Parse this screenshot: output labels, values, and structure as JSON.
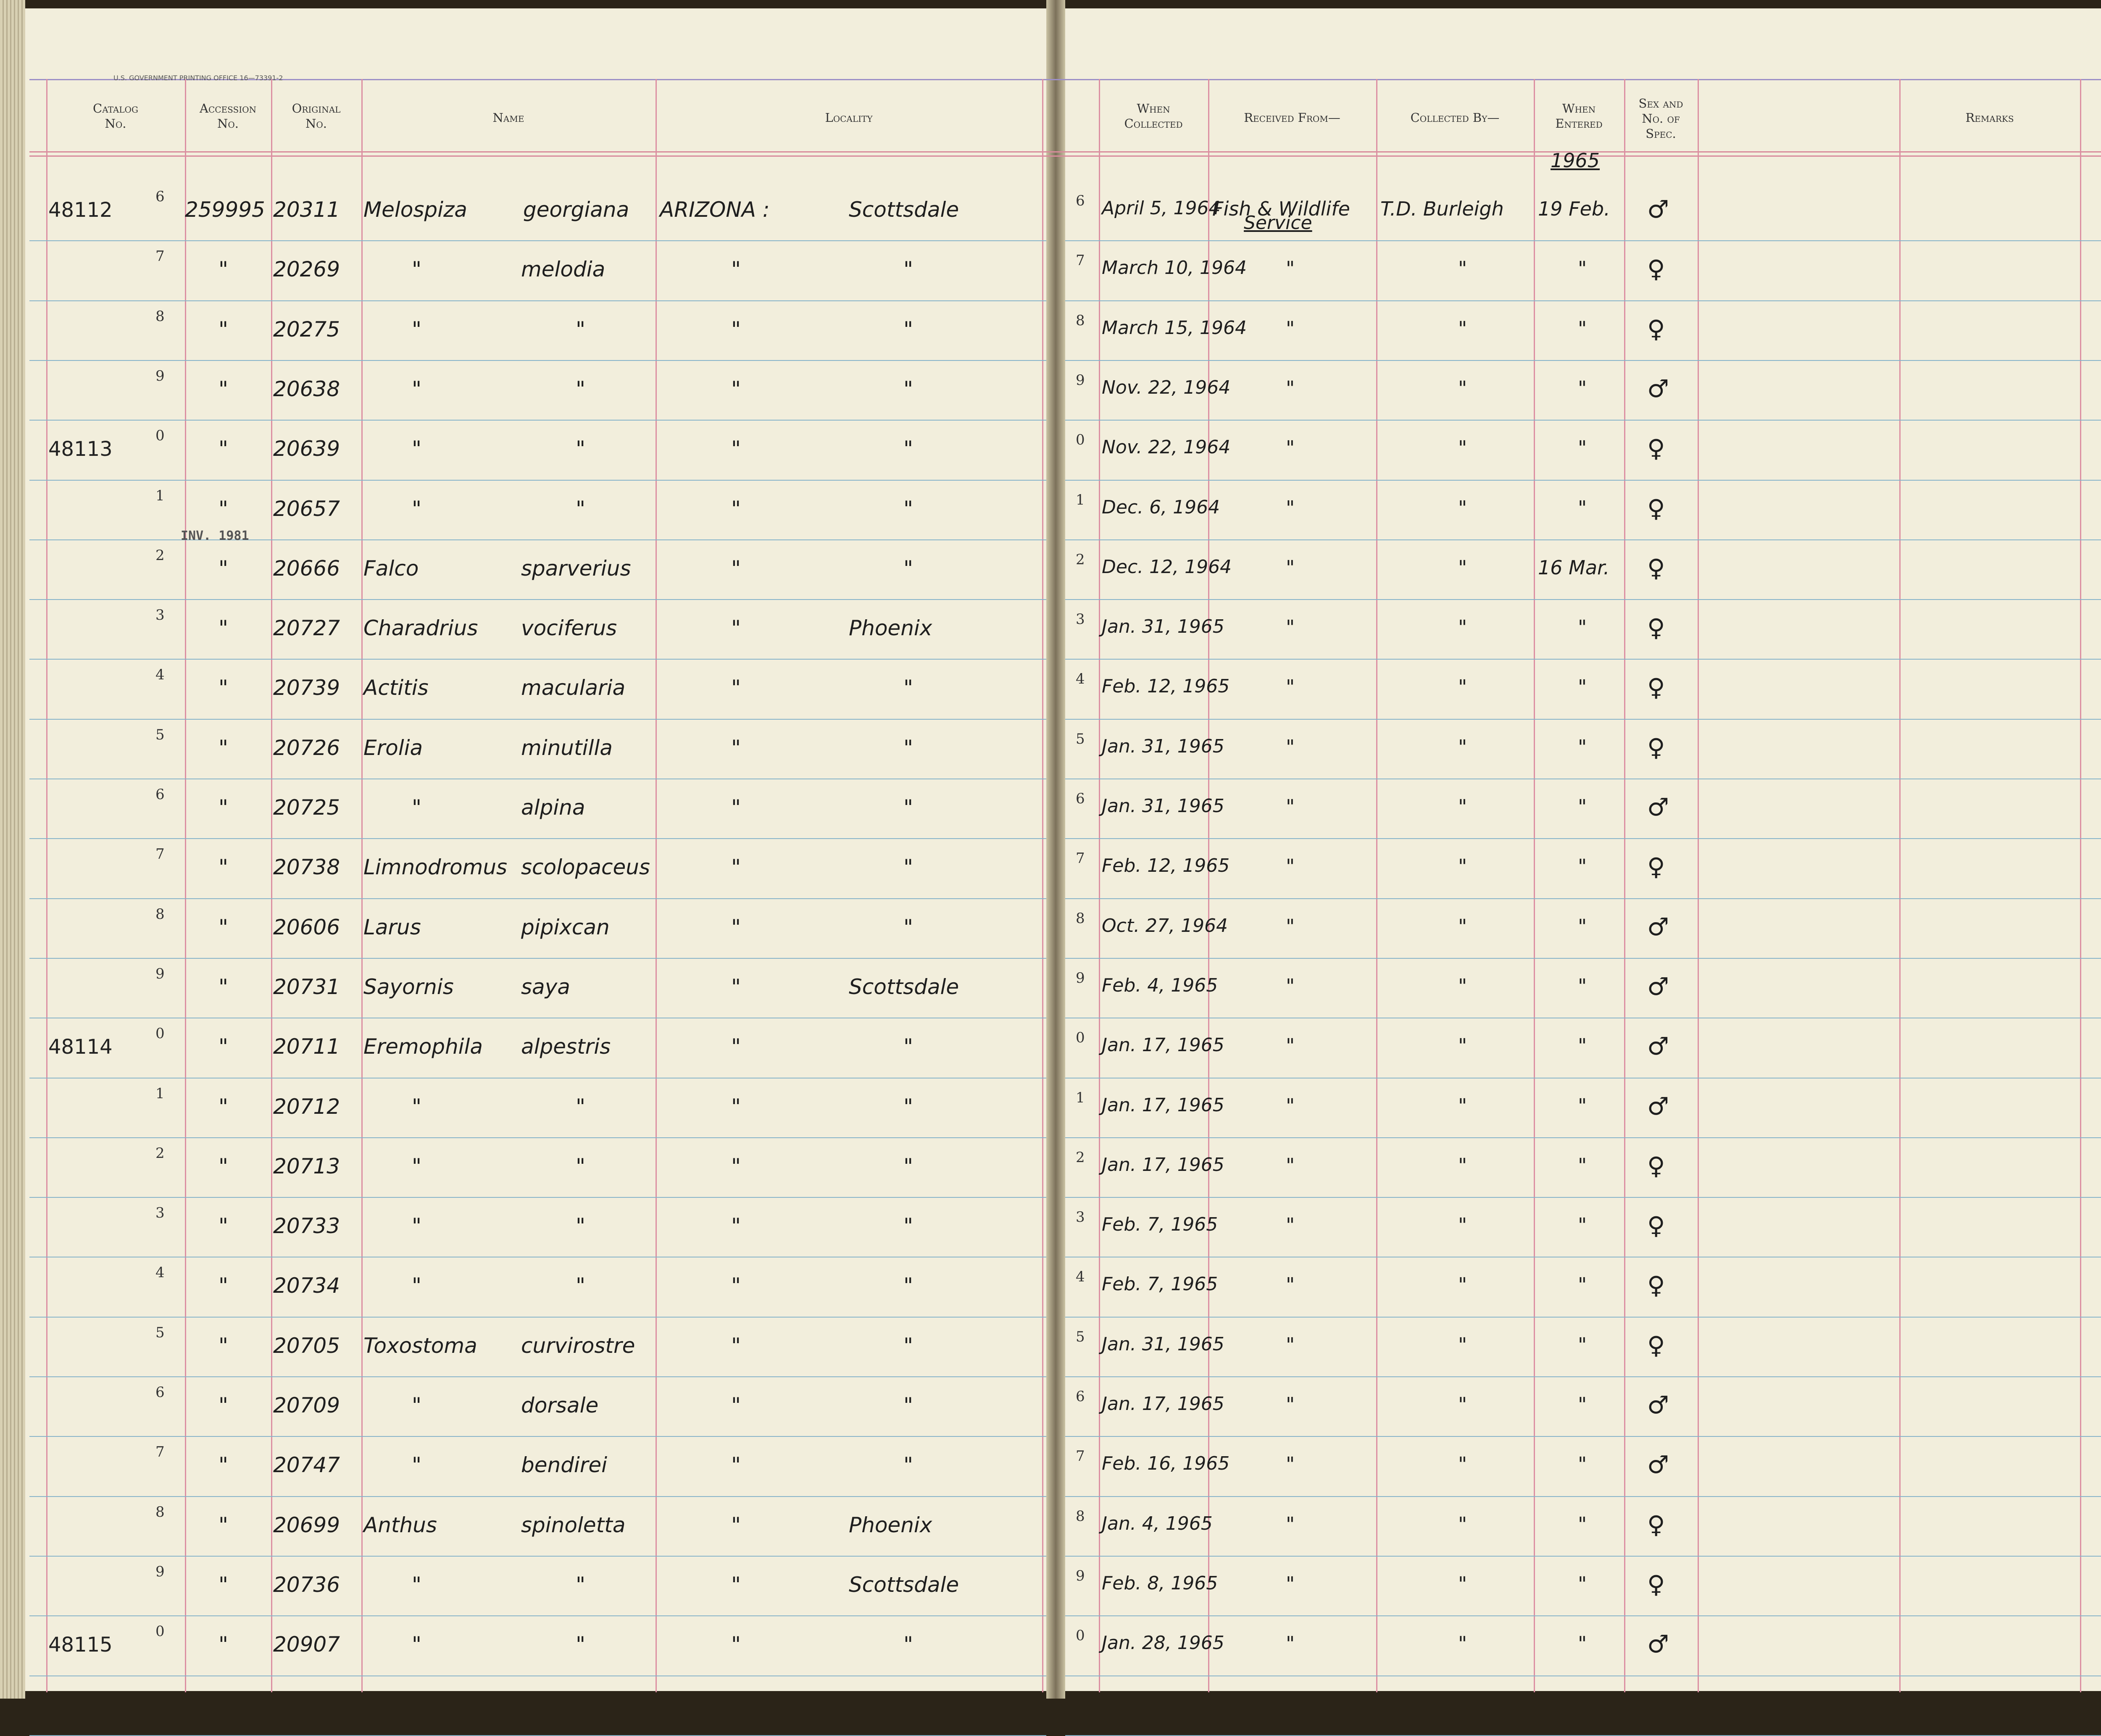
{
  "printer_imprint": "U.S. GOVERNMENT PRINTING OFFICE  16—73391-2",
  "headers": {
    "catalog": [
      "Catalog",
      "No."
    ],
    "accession": [
      "Accession",
      "No."
    ],
    "original": [
      "Original",
      "No."
    ],
    "name": [
      "Name"
    ],
    "locality": [
      "Locality"
    ],
    "when_collected": [
      "When",
      "Collected"
    ],
    "received_from": [
      "Received From—"
    ],
    "collected_by": [
      "Collected By—"
    ],
    "when_entered": [
      "When",
      "Entered"
    ],
    "sex": [
      "Sex and",
      "No. of",
      "Spec."
    ],
    "remarks": [
      "Remarks"
    ]
  },
  "year_entered": "1965",
  "stamp": "INV. 1981",
  "received_from_line2": "Service",
  "rows": [
    {
      "digit": "6",
      "catalog": "48112",
      "accession": "259995",
      "original": "20311",
      "genus": "Melospiza",
      "species": "georgiana",
      "state": "ARIZONA :",
      "place": "Scottsdale",
      "rdigit": "6",
      "date": "April 5, 1964",
      "received": "Fish & Wildlife",
      "collector": "T.D. Burleigh",
      "entered": "19 Feb.",
      "sex": "♂"
    },
    {
      "digit": "7",
      "catalog": "",
      "accession": "\"",
      "original": "20269",
      "genus": "\"",
      "species": "melodia",
      "state": "\"",
      "place": "\"",
      "rdigit": "7",
      "date": "March 10, 1964",
      "received": "\"",
      "collector": "\"",
      "entered": "\"",
      "sex": "♀"
    },
    {
      "digit": "8",
      "catalog": "",
      "accession": "\"",
      "original": "20275",
      "genus": "\"",
      "species": "\"",
      "state": "\"",
      "place": "\"",
      "rdigit": "8",
      "date": "March 15, 1964",
      "received": "\"",
      "collector": "\"",
      "entered": "\"",
      "sex": "♀"
    },
    {
      "digit": "9",
      "catalog": "",
      "accession": "\"",
      "original": "20638",
      "genus": "\"",
      "species": "\"",
      "state": "\"",
      "place": "\"",
      "rdigit": "9",
      "date": "Nov. 22, 1964",
      "received": "\"",
      "collector": "\"",
      "entered": "\"",
      "sex": "♂"
    },
    {
      "digit": "0",
      "catalog": "48113",
      "accession": "\"",
      "original": "20639",
      "genus": "\"",
      "species": "\"",
      "state": "\"",
      "place": "\"",
      "rdigit": "0",
      "date": "Nov. 22, 1964",
      "received": "\"",
      "collector": "\"",
      "entered": "\"",
      "sex": "♀"
    },
    {
      "digit": "1",
      "catalog": "",
      "accession": "\"",
      "original": "20657",
      "genus": "\"",
      "species": "\"",
      "state": "\"",
      "place": "\"",
      "rdigit": "1",
      "date": "Dec. 6, 1964",
      "received": "\"",
      "collector": "\"",
      "entered": "\"",
      "sex": "♀"
    },
    {
      "digit": "2",
      "catalog": "",
      "accession": "\"",
      "original": "20666",
      "genus": "Falco",
      "species": "sparverius",
      "state": "\"",
      "place": "\"",
      "rdigit": "2",
      "date": "Dec. 12, 1964",
      "received": "\"",
      "collector": "\"",
      "entered": "16 Mar.",
      "sex": "♀"
    },
    {
      "digit": "3",
      "catalog": "",
      "accession": "\"",
      "original": "20727",
      "genus": "Charadrius",
      "species": "vociferus",
      "state": "\"",
      "place": "Phoenix",
      "rdigit": "3",
      "date": "Jan. 31, 1965",
      "received": "\"",
      "collector": "\"",
      "entered": "\"",
      "sex": "♀"
    },
    {
      "digit": "4",
      "catalog": "",
      "accession": "\"",
      "original": "20739",
      "genus": "Actitis",
      "species": "macularia",
      "state": "\"",
      "place": "\"",
      "rdigit": "4",
      "date": "Feb. 12, 1965",
      "received": "\"",
      "collector": "\"",
      "entered": "\"",
      "sex": "♀"
    },
    {
      "digit": "5",
      "catalog": "",
      "accession": "\"",
      "original": "20726",
      "genus": "Erolia",
      "species": "minutilla",
      "state": "\"",
      "place": "\"",
      "rdigit": "5",
      "date": "Jan. 31, 1965",
      "received": "\"",
      "collector": "\"",
      "entered": "\"",
      "sex": "♀"
    },
    {
      "digit": "6",
      "catalog": "",
      "accession": "\"",
      "original": "20725",
      "genus": "\"",
      "species": "alpina",
      "state": "\"",
      "place": "\"",
      "rdigit": "6",
      "date": "Jan. 31, 1965",
      "received": "\"",
      "collector": "\"",
      "entered": "\"",
      "sex": "♂"
    },
    {
      "digit": "7",
      "catalog": "",
      "accession": "\"",
      "original": "20738",
      "genus": "Limnodromus",
      "species": "scolopaceus",
      "state": "\"",
      "place": "\"",
      "rdigit": "7",
      "date": "Feb. 12, 1965",
      "received": "\"",
      "collector": "\"",
      "entered": "\"",
      "sex": "♀"
    },
    {
      "digit": "8",
      "catalog": "",
      "accession": "\"",
      "original": "20606",
      "genus": "Larus",
      "species": "pipixcan",
      "state": "\"",
      "place": "\"",
      "rdigit": "8",
      "date": "Oct. 27, 1964",
      "received": "\"",
      "collector": "\"",
      "entered": "\"",
      "sex": "♂"
    },
    {
      "digit": "9",
      "catalog": "",
      "accession": "\"",
      "original": "20731",
      "genus": "Sayornis",
      "species": "saya",
      "state": "\"",
      "place": "Scottsdale",
      "rdigit": "9",
      "date": "Feb. 4, 1965",
      "received": "\"",
      "collector": "\"",
      "entered": "\"",
      "sex": "♂"
    },
    {
      "digit": "0",
      "catalog": "48114",
      "accession": "\"",
      "original": "20711",
      "genus": "Eremophila",
      "species": "alpestris",
      "state": "\"",
      "place": "\"",
      "rdigit": "0",
      "date": "Jan. 17, 1965",
      "received": "\"",
      "collector": "\"",
      "entered": "\"",
      "sex": "♂"
    },
    {
      "digit": "1",
      "catalog": "",
      "accession": "\"",
      "original": "20712",
      "genus": "\"",
      "species": "\"",
      "state": "\"",
      "place": "\"",
      "rdigit": "1",
      "date": "Jan. 17, 1965",
      "received": "\"",
      "collector": "\"",
      "entered": "\"",
      "sex": "♂"
    },
    {
      "digit": "2",
      "catalog": "",
      "accession": "\"",
      "original": "20713",
      "genus": "\"",
      "species": "\"",
      "state": "\"",
      "place": "\"",
      "rdigit": "2",
      "date": "Jan. 17, 1965",
      "received": "\"",
      "collector": "\"",
      "entered": "\"",
      "sex": "♀"
    },
    {
      "digit": "3",
      "catalog": "",
      "accession": "\"",
      "original": "20733",
      "genus": "\"",
      "species": "\"",
      "state": "\"",
      "place": "\"",
      "rdigit": "3",
      "date": "Feb. 7, 1965",
      "received": "\"",
      "collector": "\"",
      "entered": "\"",
      "sex": "♀"
    },
    {
      "digit": "4",
      "catalog": "",
      "accession": "\"",
      "original": "20734",
      "genus": "\"",
      "species": "\"",
      "state": "\"",
      "place": "\"",
      "rdigit": "4",
      "date": "Feb. 7, 1965",
      "received": "\"",
      "collector": "\"",
      "entered": "\"",
      "sex": "♀"
    },
    {
      "digit": "5",
      "catalog": "",
      "accession": "\"",
      "original": "20705",
      "genus": "Toxostoma",
      "species": "curvirostre",
      "state": "\"",
      "place": "\"",
      "rdigit": "5",
      "date": "Jan. 31, 1965",
      "received": "\"",
      "collector": "\"",
      "entered": "\"",
      "sex": "♀"
    },
    {
      "digit": "6",
      "catalog": "",
      "accession": "\"",
      "original": "20709",
      "genus": "\"",
      "species": "dorsale",
      "state": "\"",
      "place": "\"",
      "rdigit": "6",
      "date": "Jan. 17, 1965",
      "received": "\"",
      "collector": "\"",
      "entered": "\"",
      "sex": "♂"
    },
    {
      "digit": "7",
      "catalog": "",
      "accession": "\"",
      "original": "20747",
      "genus": "\"",
      "species": "bendirei",
      "state": "\"",
      "place": "\"",
      "rdigit": "7",
      "date": "Feb. 16, 1965",
      "received": "\"",
      "collector": "\"",
      "entered": "\"",
      "sex": "♂"
    },
    {
      "digit": "8",
      "catalog": "",
      "accession": "\"",
      "original": "20699",
      "genus": "Anthus",
      "species": "spinoletta",
      "state": "\"",
      "place": "Phoenix",
      "rdigit": "8",
      "date": "Jan. 4, 1965",
      "received": "\"",
      "collector": "\"",
      "entered": "\"",
      "sex": "♀"
    },
    {
      "digit": "9",
      "catalog": "",
      "accession": "\"",
      "original": "20736",
      "genus": "\"",
      "species": "\"",
      "state": "\"",
      "place": "Scottsdale",
      "rdigit": "9",
      "date": "Feb. 8, 1965",
      "received": "\"",
      "collector": "\"",
      "entered": "\"",
      "sex": "♀"
    },
    {
      "digit": "0",
      "catalog": "48115",
      "accession": "\"",
      "original": "20907",
      "genus": "\"",
      "species": "\"",
      "state": "\"",
      "place": "\"",
      "rdigit": "0",
      "date": "Jan. 28, 1965",
      "received": "\"",
      "collector": "\"",
      "entered": "\"",
      "sex": "♂"
    }
  ]
}
